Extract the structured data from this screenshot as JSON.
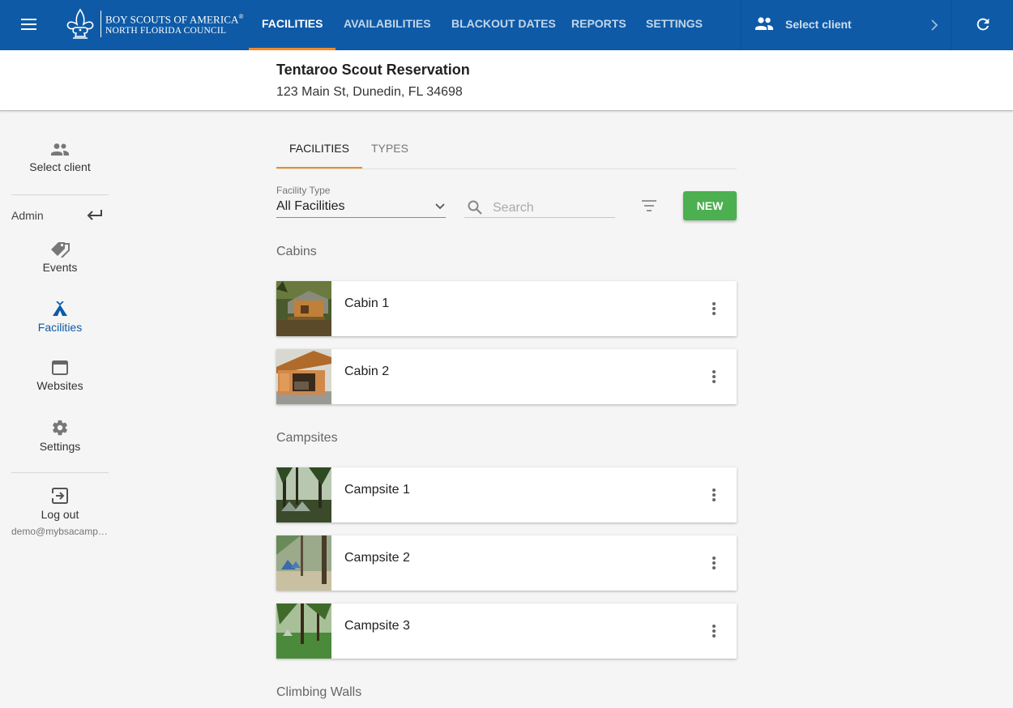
{
  "app": {
    "org_line1": "BOY SCOUTS OF AMERICA",
    "org_mark": "®",
    "org_line2": "NORTH FLORIDA COUNCIL"
  },
  "topnav": {
    "tabs": [
      {
        "label": "FACILITIES",
        "active": true
      },
      {
        "label": "AVAILABILITIES",
        "active": false
      },
      {
        "label": "BLACKOUT DATES",
        "active": false
      },
      {
        "label": "REPORTS",
        "active": false
      },
      {
        "label": "SETTINGS",
        "active": false
      }
    ],
    "client_label": "Select client"
  },
  "facility": {
    "name": "Tentaroo Scout Reservation",
    "address": "123 Main St, Dunedin, FL 34698"
  },
  "sidebar": {
    "select_client": "Select client",
    "admin_label": "Admin",
    "items": [
      {
        "label": "Events",
        "icon": "tag-icon",
        "active": false
      },
      {
        "label": "Facilities",
        "icon": "tent-icon",
        "active": true
      },
      {
        "label": "Websites",
        "icon": "browser-window-icon",
        "active": false
      },
      {
        "label": "Settings",
        "icon": "gear-icon",
        "active": false
      }
    ],
    "logout_label": "Log out",
    "user_email": "demo@mybsacamp.org"
  },
  "content_tabs": [
    {
      "label": "FACILITIES",
      "active": true
    },
    {
      "label": "TYPES",
      "active": false
    }
  ],
  "filters": {
    "type_label": "Facility Type",
    "type_value": "All Facilities",
    "search_placeholder": "Search",
    "new_label": "NEW"
  },
  "groups": [
    {
      "title": "Cabins",
      "items": [
        {
          "name": "Cabin 1"
        },
        {
          "name": "Cabin 2"
        }
      ]
    },
    {
      "title": "Campsites",
      "items": [
        {
          "name": "Campsite 1"
        },
        {
          "name": "Campsite 2"
        },
        {
          "name": "Campsite 3"
        }
      ]
    },
    {
      "title": "Climbing Walls",
      "items": []
    }
  ],
  "colors": {
    "primary": "#0e5aa7",
    "accent": "#ef8c2a",
    "new_button": "#4caf50"
  }
}
